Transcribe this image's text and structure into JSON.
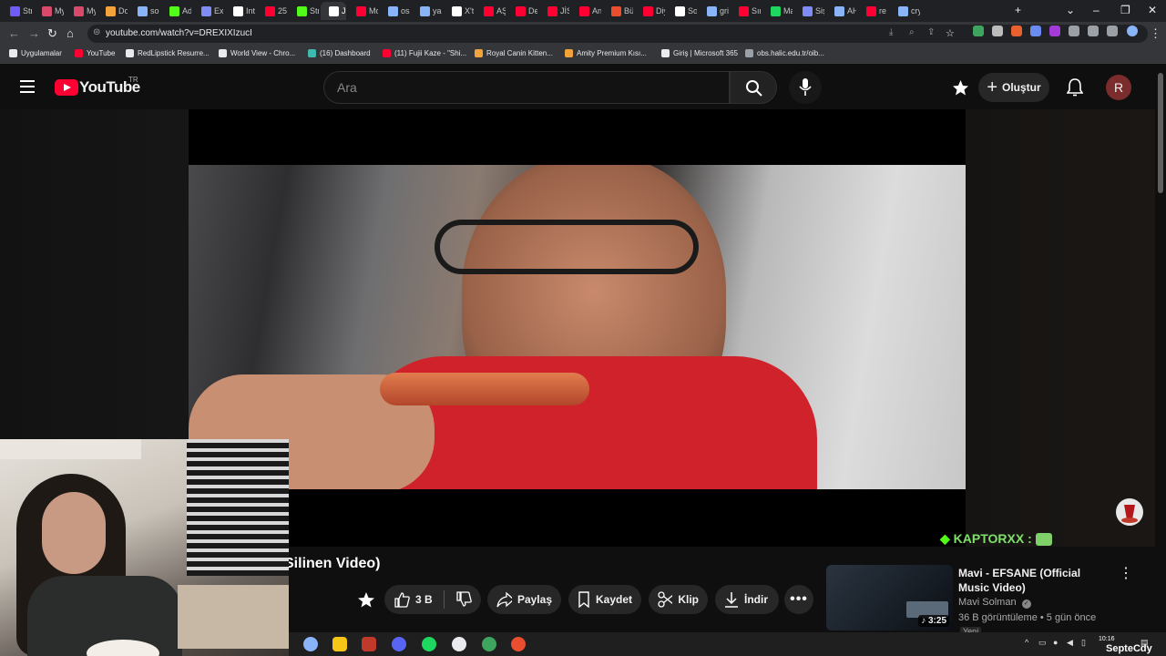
{
  "tabs": [
    {
      "label": "Str",
      "color": "#6d5cf5"
    },
    {
      "label": "My",
      "color": "#d84a6a"
    },
    {
      "label": "My",
      "color": "#d84a6a"
    },
    {
      "label": "Do",
      "color": "#f2a33a"
    },
    {
      "label": "sor",
      "color": "#8ab4f8"
    },
    {
      "label": "Ad",
      "color": "#53fc18"
    },
    {
      "label": "Exc",
      "color": "#7f8cf5"
    },
    {
      "label": "Int",
      "color": "#ffffff"
    },
    {
      "label": "25",
      "color": "#ff0033"
    },
    {
      "label": "Str",
      "color": "#53fc18"
    },
    {
      "label": "J",
      "color": "#ffffff",
      "active": true
    },
    {
      "label": "Mo",
      "color": "#ff0033"
    },
    {
      "label": "osc",
      "color": "#8ab4f8"
    },
    {
      "label": "yal",
      "color": "#8ab4f8"
    },
    {
      "label": "X'te",
      "color": "#ffffff"
    },
    {
      "label": "AŞ",
      "color": "#ff0033"
    },
    {
      "label": "De",
      "color": "#ff0033"
    },
    {
      "label": "JİSİ",
      "color": "#ff0033"
    },
    {
      "label": "An",
      "color": "#ff0033"
    },
    {
      "label": "Bü",
      "color": "#e94f2f"
    },
    {
      "label": "Diy",
      "color": "#ff0033"
    },
    {
      "label": "So",
      "color": "#ffffff"
    },
    {
      "label": "gri",
      "color": "#8ab4f8"
    },
    {
      "label": "Sır",
      "color": "#ff0033"
    },
    {
      "label": "Ma",
      "color": "#1ed760"
    },
    {
      "label": "Siş",
      "color": "#7f8cf5"
    },
    {
      "label": "AH",
      "color": "#8ab4f8"
    },
    {
      "label": "re",
      "color": "#ff0033"
    },
    {
      "label": "cry",
      "color": "#8ab4f8"
    }
  ],
  "address_bar": {
    "url": "youtube.com/watch?v=DREXIXIzucI"
  },
  "bookmarks": [
    {
      "label": "Uygulamalar",
      "color": "#e8eaed"
    },
    {
      "label": "YouTube",
      "color": "#ff0033"
    },
    {
      "label": "RedLipstick Resurre...",
      "color": "#e8eaed"
    },
    {
      "label": "World View - Chro...",
      "color": "#e8eaed"
    },
    {
      "label": "(16) Dashboard",
      "color": "#3fb8af"
    },
    {
      "label": "(11) Fujii Kaze - \"Shi...",
      "color": "#ff0033"
    },
    {
      "label": "Royal Canin Kitten...",
      "color": "#f2a33a"
    },
    {
      "label": "Amity Premium Kısı...",
      "color": "#f2a33a"
    },
    {
      "label": "Giriş | Microsoft 365",
      "color": "#e8eaed"
    },
    {
      "label": "obs.halic.edu.tr/oib...",
      "color": "#9aa0a6"
    }
  ],
  "youtube": {
    "logo_text": "YouTube",
    "country_code": "TR",
    "search_placeholder": "Ara",
    "create_label": "Oluştur",
    "avatar_letter": "R"
  },
  "stream_overlay": {
    "text": "KAPTORXX : "
  },
  "video": {
    "title": "Silinen Video)",
    "like_count": "3 B",
    "share_label": "Paylaş",
    "save_label": "Kaydet",
    "clip_label": "Klip",
    "download_label": "İndir"
  },
  "recommendation": {
    "title": "Mavi - EFSANE (Official Music Video)",
    "channel": "Mavi Solman",
    "meta": "36 B görüntüleme • 5 gün önce",
    "duration": "3:25",
    "badge": "Yeni"
  },
  "taskbar": {
    "clock_time": "10:16",
    "watermark": "SepteCdy"
  }
}
